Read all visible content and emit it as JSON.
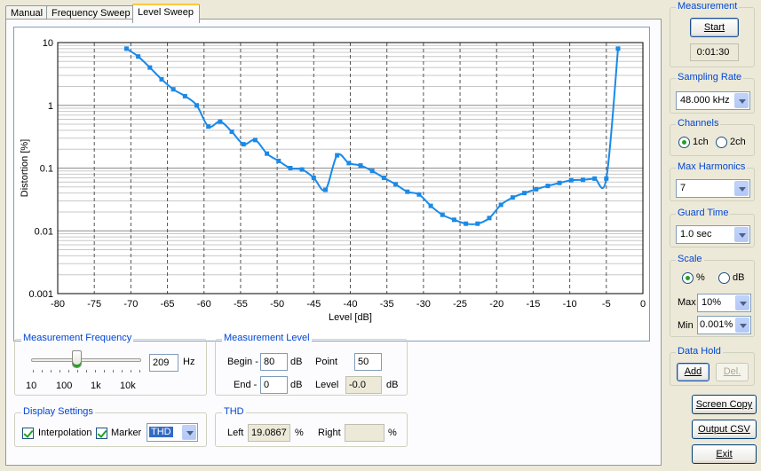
{
  "tabs": [
    "Manual",
    "Frequency Sweep",
    "Level Sweep"
  ],
  "active_tab": "Level Sweep",
  "chart_data": {
    "type": "line",
    "xlabel": "Level [dB]",
    "ylabel": "Distortion [%]",
    "xlim": [
      -80,
      0
    ],
    "ylim": [
      0.001,
      10
    ],
    "yscale": "log",
    "grid": true,
    "line_color": "#1a8ae8",
    "x_ticks": [
      "-80",
      "-75",
      "-70",
      "-65",
      "-60",
      "-55",
      "-50",
      "-45",
      "-40",
      "-35",
      "-30",
      "-25",
      "-20",
      "-15",
      "-10",
      "-5",
      "0"
    ],
    "y_ticks": [
      "10",
      "1",
      "0.1",
      "0.01",
      "0.001"
    ],
    "series": [
      {
        "x": [
          -70.6,
          -69.0,
          -67.4,
          -65.8,
          -64.2,
          -62.6,
          -61.0,
          -59.4,
          -57.8,
          -56.2,
          -54.6,
          -53.0,
          -51.4,
          -49.8,
          -48.2,
          -46.6,
          -45.0,
          -43.4,
          -41.8,
          -40.2,
          -38.6,
          -37.0,
          -35.4,
          -33.8,
          -32.2,
          -30.6,
          -29.0,
          -27.4,
          -25.8,
          -24.2,
          -22.6,
          -21.0,
          -19.4,
          -17.8,
          -16.2,
          -14.6,
          -13.0,
          -11.4,
          -9.8,
          -8.2,
          -6.6,
          -5.0,
          -3.4
        ],
        "y": [
          8.0,
          6.0,
          4.0,
          2.6,
          1.8,
          1.4,
          1.0,
          0.46,
          0.55,
          0.38,
          0.24,
          0.28,
          0.17,
          0.13,
          0.1,
          0.095,
          0.07,
          0.045,
          0.16,
          0.12,
          0.11,
          0.09,
          0.07,
          0.055,
          0.042,
          0.038,
          0.025,
          0.018,
          0.015,
          0.013,
          0.013,
          0.016,
          0.026,
          0.034,
          0.04,
          0.046,
          0.052,
          0.058,
          0.064,
          0.065,
          0.068,
          0.068,
          8.0
        ]
      }
    ]
  },
  "measurement_frequency": {
    "title": "Measurement Frequency",
    "value": "209",
    "unit": "Hz",
    "scale_labels": [
      "10",
      "100",
      "1k",
      "10k"
    ]
  },
  "measurement_level": {
    "title": "Measurement Level",
    "begin_label": "Begin -",
    "begin_value": "80",
    "begin_unit": "dB",
    "end_label": "End -",
    "end_value": "0",
    "end_unit": "dB",
    "point_label": "Point",
    "point_value": "50",
    "level_label": "Level",
    "level_value": "-0.0",
    "level_unit": "dB"
  },
  "display_settings": {
    "title": "Display Settings",
    "interpolation_label": "Interpolation",
    "interpolation_checked": true,
    "marker_label": "Marker",
    "marker_checked": true,
    "marker_type": "THD"
  },
  "thd": {
    "title": "THD",
    "left_label": "Left",
    "left_value": "19.0867",
    "left_unit": "%",
    "right_label": "Right",
    "right_value": "",
    "right_unit": "%"
  },
  "measurement": {
    "title": "Measurement",
    "start_label": "Start",
    "time": "0:01:30"
  },
  "sampling_rate": {
    "title": "Sampling Rate",
    "value": "48.000 kHz"
  },
  "channels": {
    "title": "Channels",
    "opt1": "1ch",
    "opt2": "2ch",
    "selected": "1ch"
  },
  "max_harmonics": {
    "title": "Max Harmonics",
    "value": "7"
  },
  "guard_time": {
    "title": "Guard Time",
    "value": "1.0 sec"
  },
  "scale": {
    "title": "Scale",
    "opt_percent": "%",
    "opt_db": "dB",
    "selected": "%",
    "max_label": "Max",
    "max_value": "10%",
    "min_label": "Min",
    "min_value": "0.001%"
  },
  "data_hold": {
    "title": "Data Hold",
    "add_label": "Add",
    "del_label": "Del."
  },
  "buttons": {
    "screen_copy": "Screen Copy",
    "output_csv": "Output CSV",
    "exit": "Exit"
  }
}
